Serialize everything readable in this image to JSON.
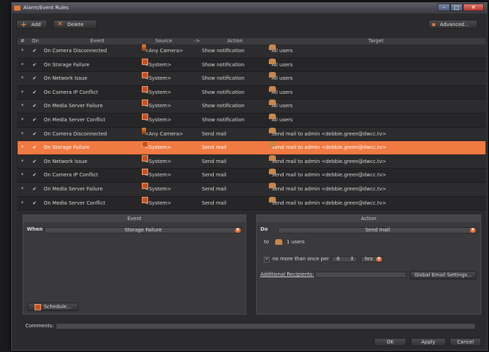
{
  "window": {
    "title": "Alarm/Event Rules"
  },
  "toolbar": {
    "add_label": "Add",
    "delete_label": "Delete",
    "advanced_label": "Advanced..."
  },
  "columns": {
    "num": "#",
    "on": "On",
    "event": "Event",
    "source": "Source",
    "arrow": "->",
    "action": "Action",
    "target": "Target"
  },
  "rules": [
    {
      "on": true,
      "event": "On Camera Disconnected",
      "source": "<Any Camera>",
      "source_icon": "camera-icon",
      "action": "Show notification",
      "target": "All users"
    },
    {
      "on": true,
      "event": "On Storage Failure",
      "source": "<System>",
      "source_icon": "server-icon",
      "action": "Show notification",
      "target": "All users"
    },
    {
      "on": true,
      "event": "On Network Issue",
      "source": "<System>",
      "source_icon": "server-icon",
      "action": "Show notification",
      "target": "All users"
    },
    {
      "on": true,
      "event": "On Camera IP Conflict",
      "source": "<System>",
      "source_icon": "server-icon",
      "action": "Show notification",
      "target": "All users"
    },
    {
      "on": true,
      "event": "On Media Server Failure",
      "source": "<System>",
      "source_icon": "server-icon",
      "action": "Show notification",
      "target": "All users"
    },
    {
      "on": true,
      "event": "On Media Server Conflict",
      "source": "<System>",
      "source_icon": "server-icon",
      "action": "Show notification",
      "target": "All users"
    },
    {
      "on": true,
      "event": "On Camera Disconnected",
      "source": "<Any Camera>",
      "source_icon": "camera-icon",
      "action": "Send mail",
      "target": "Send mail to admin <debbie.green@dwcc.tv>"
    },
    {
      "on": true,
      "event": "On Storage Failure",
      "source": "<System>",
      "source_icon": "server-icon",
      "action": "Send mail",
      "target": "Send mail to admin <debbie.green@dwcc.tv>",
      "selected": true
    },
    {
      "on": true,
      "event": "On Network Issue",
      "source": "<System>",
      "source_icon": "server-icon",
      "action": "Send mail",
      "target": "Send mail to admin <debbie.green@dwcc.tv>"
    },
    {
      "on": true,
      "event": "On Camera IP Conflict",
      "source": "<System>",
      "source_icon": "server-icon",
      "action": "Send mail",
      "target": "Send mail to admin <debbie.green@dwcc.tv>"
    },
    {
      "on": true,
      "event": "On Media Server Failure",
      "source": "<System>",
      "source_icon": "server-icon",
      "action": "Send mail",
      "target": "Send mail to admin <debbie.green@dwcc.tv>"
    },
    {
      "on": true,
      "event": "On Media Server Conflict",
      "source": "<System>",
      "source_icon": "server-icon",
      "action": "Send mail",
      "target": "Send mail to admin <debbie.green@dwcc.tv>"
    }
  ],
  "event_panel": {
    "header": "Event",
    "when_label": "When",
    "when_value": "Storage Failure",
    "schedule_label": "Schedule..."
  },
  "action_panel": {
    "header": "Action",
    "do_label": "Do",
    "do_value": "Send mail",
    "to_label": "to",
    "to_value": "1 users",
    "throttle_label": "no more than once per",
    "throttle_value": "6",
    "throttle_unit": "hrs",
    "recipients_label": "Additional Recipients:",
    "recipients_value": "",
    "email_settings_label": "Global Email Settings..."
  },
  "comments": {
    "label": "Comments:",
    "value": ""
  },
  "footer": {
    "ok_label": "OK",
    "apply_label": "Apply",
    "cancel_label": "Cancel"
  },
  "colors": {
    "accent": "#f07a42",
    "background": "#2b2b2d",
    "row_alt": "#262628"
  }
}
